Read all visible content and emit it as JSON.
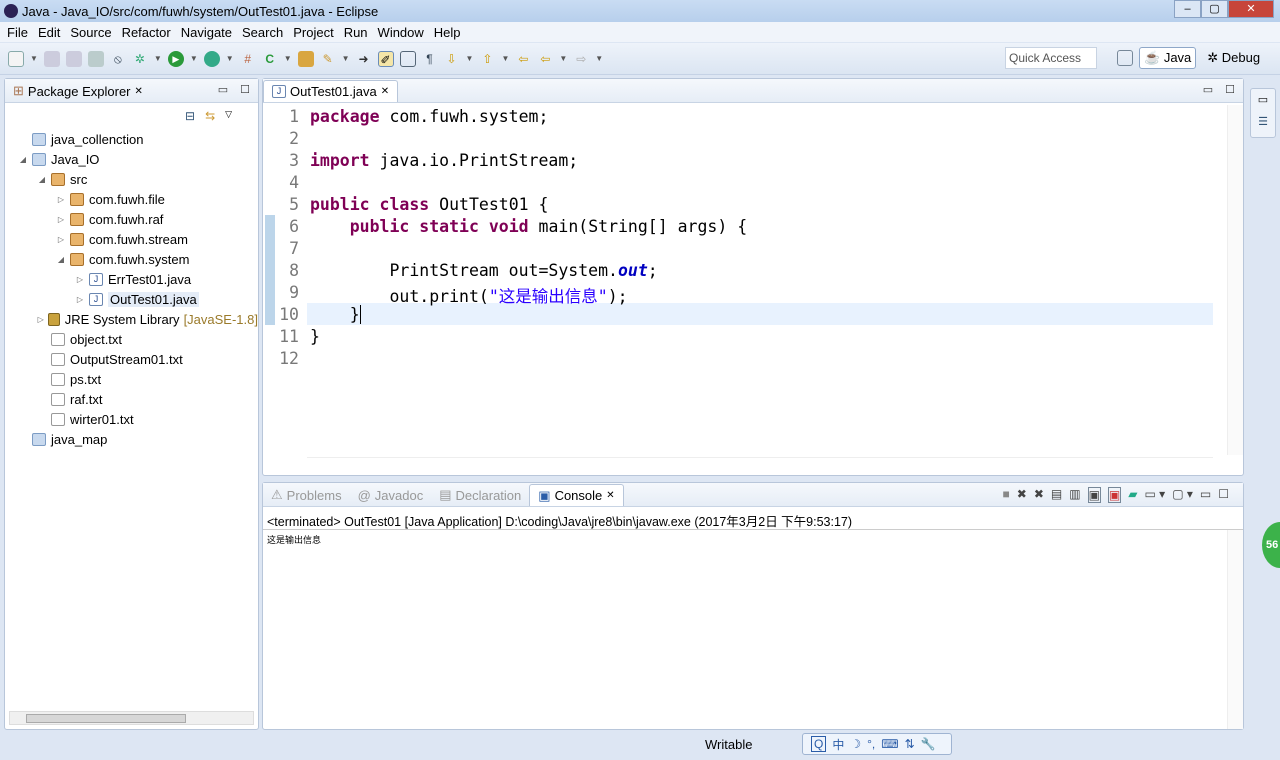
{
  "window": {
    "title": "Java - Java_IO/src/com/fuwh/system/OutTest01.java - Eclipse",
    "controls": [
      "–",
      "▢",
      "✕"
    ]
  },
  "menu": [
    "File",
    "Edit",
    "Source",
    "Refactor",
    "Navigate",
    "Search",
    "Project",
    "Run",
    "Window",
    "Help"
  ],
  "toolbar": {
    "quick_access": "Quick Access",
    "perspectives": [
      "Java",
      "Debug"
    ]
  },
  "package_explorer": {
    "title": "Package Explorer",
    "items": [
      {
        "label": "java_collenction",
        "depth": 0,
        "type": "project",
        "twisty": ""
      },
      {
        "label": "Java_IO",
        "depth": 0,
        "type": "project-open",
        "twisty": "◢"
      },
      {
        "label": "src",
        "depth": 1,
        "type": "srcfolder",
        "twisty": "◢"
      },
      {
        "label": "com.fuwh.file",
        "depth": 2,
        "type": "package",
        "twisty": "▷"
      },
      {
        "label": "com.fuwh.raf",
        "depth": 2,
        "type": "package",
        "twisty": "▷"
      },
      {
        "label": "com.fuwh.stream",
        "depth": 2,
        "type": "package",
        "twisty": "▷"
      },
      {
        "label": "com.fuwh.system",
        "depth": 2,
        "type": "package",
        "twisty": "◢"
      },
      {
        "label": "ErrTest01.java",
        "depth": 3,
        "type": "java",
        "twisty": "▷"
      },
      {
        "label": "OutTest01.java",
        "depth": 3,
        "type": "java",
        "twisty": "▷",
        "selected": true
      },
      {
        "label": "JRE System Library",
        "suffix": "[JavaSE-1.8]",
        "depth": 1,
        "type": "library",
        "twisty": "▷"
      },
      {
        "label": "object.txt",
        "depth": 1,
        "type": "file",
        "twisty": ""
      },
      {
        "label": "OutputStream01.txt",
        "depth": 1,
        "type": "file",
        "twisty": ""
      },
      {
        "label": "ps.txt",
        "depth": 1,
        "type": "file",
        "twisty": ""
      },
      {
        "label": "raf.txt",
        "depth": 1,
        "type": "file",
        "twisty": ""
      },
      {
        "label": "wirter01.txt",
        "depth": 1,
        "type": "file",
        "twisty": ""
      },
      {
        "label": "java_map",
        "depth": 0,
        "type": "project",
        "twisty": ""
      }
    ]
  },
  "editor": {
    "tab": "OutTest01.java",
    "current_line": 10,
    "lines": [
      [
        {
          "k": "kw",
          "t": "package"
        },
        {
          "t": " com.fuwh.system;"
        }
      ],
      [],
      [
        {
          "k": "kw",
          "t": "import"
        },
        {
          "t": " java.io.PrintStream;"
        }
      ],
      [],
      [
        {
          "k": "kw",
          "t": "public"
        },
        {
          "t": " "
        },
        {
          "k": "kw",
          "t": "class"
        },
        {
          "t": " OutTest01 {"
        }
      ],
      [
        {
          "t": "    "
        },
        {
          "k": "kw",
          "t": "public"
        },
        {
          "t": " "
        },
        {
          "k": "kw",
          "t": "static"
        },
        {
          "t": " "
        },
        {
          "k": "kw",
          "t": "void"
        },
        {
          "t": " main(String[] args) {"
        }
      ],
      [],
      [
        {
          "t": "        PrintStream out=System."
        },
        {
          "k": "fld",
          "t": "out"
        },
        {
          "t": ";"
        }
      ],
      [
        {
          "t": "        out.print("
        },
        {
          "k": "str",
          "t": "\"这是输出信息\""
        },
        {
          "t": ");"
        }
      ],
      [
        {
          "t": "    }"
        }
      ],
      [
        {
          "t": "}"
        }
      ],
      []
    ]
  },
  "console": {
    "tabs": [
      "Problems",
      "Javadoc",
      "Declaration",
      "Console"
    ],
    "active": "Console",
    "description": "<terminated> OutTest01 [Java Application] D:\\coding\\Java\\jre8\\bin\\javaw.exe (2017年3月2日 下午9:53:17)",
    "output": "这是输出信息"
  },
  "status": {
    "writable": "Writable",
    "ime": [
      "中",
      "☽",
      "°,",
      "⌨",
      "⇅",
      "🔧"
    ],
    "badge": "56"
  }
}
